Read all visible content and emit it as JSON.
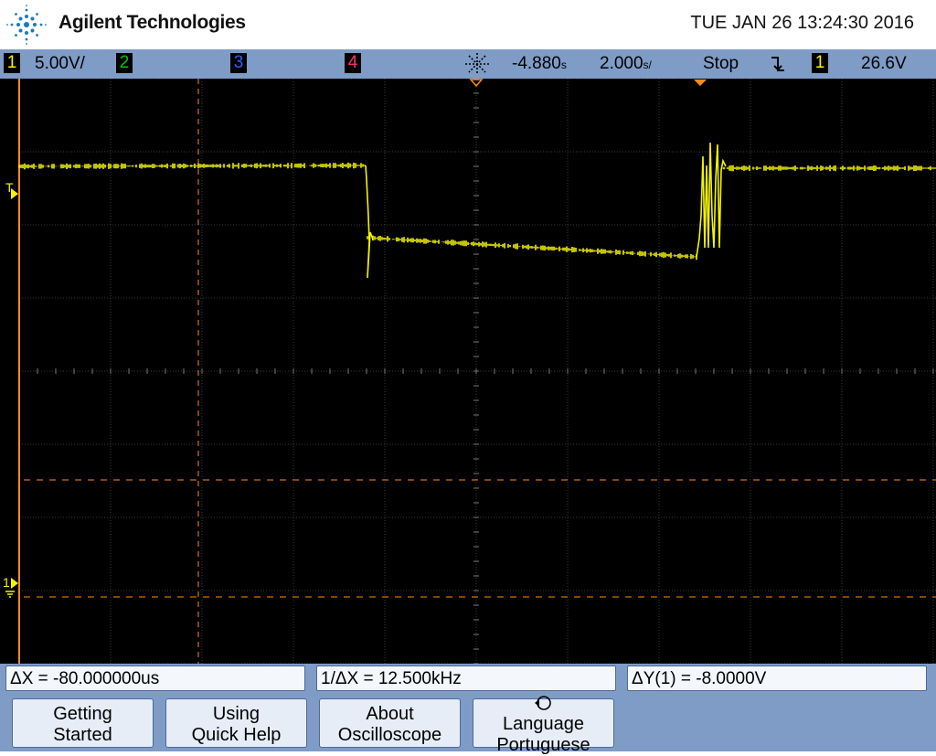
{
  "header": {
    "brand": "Agilent Technologies",
    "datetime": "TUE JAN 26 13:24:30 2016"
  },
  "status": {
    "ch1_num": "1",
    "ch1_scale": "5.00V/",
    "ch2_num": "2",
    "ch3_num": "3",
    "ch4_num": "4",
    "time_offset": "-4.880",
    "time_unit_1": "s",
    "timebase": "2.000",
    "time_unit_2": "s/",
    "run_state": "Stop",
    "trigger_slope_icon": "falling-edge",
    "trig_source": "1",
    "trig_level": "26.6V"
  },
  "screen": {
    "trigger_marker": "T",
    "ground_marker": "1"
  },
  "measurements": {
    "delta_x": "ΔX = -80.000000us",
    "inv_delta_x": "1/ΔX = 12.500kHz",
    "delta_y": "ΔY(1) = -8.0000V"
  },
  "softkeys": [
    {
      "line1": "Getting",
      "line2": "Started"
    },
    {
      "line1": "Using",
      "line2": "Quick Help"
    },
    {
      "line1": "About",
      "line2": "Oscilloscope"
    },
    {
      "line1": "Language",
      "line2": "Portuguese"
    }
  ],
  "colors": {
    "ch1": "#f5f500",
    "ch2": "#00c800",
    "ch3": "#3060ff",
    "ch4": "#ff3070",
    "cursor": "#ff8c1a",
    "panel": "#7e9cc6"
  }
}
